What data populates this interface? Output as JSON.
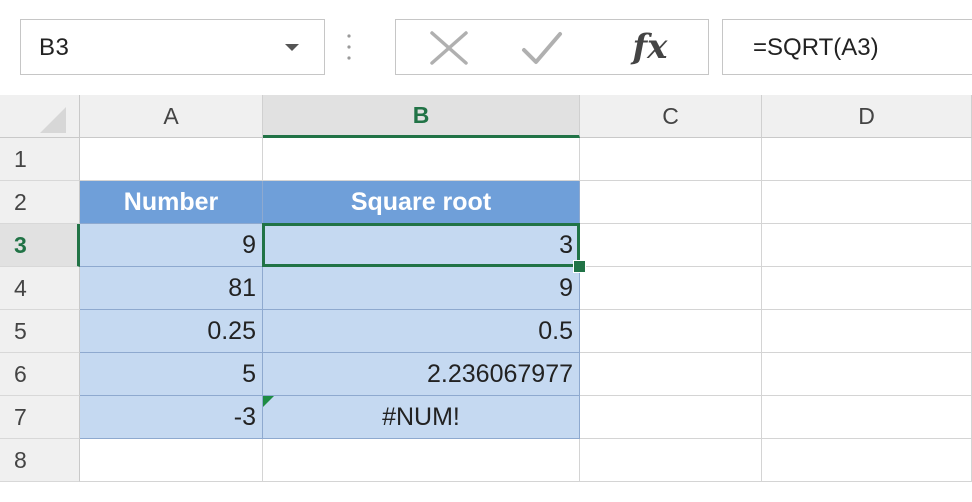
{
  "formula_bar": {
    "name_box": "B3",
    "formula": "=SQRT(A3)",
    "fx_label": "fx"
  },
  "columns": [
    "A",
    "B",
    "C",
    "D"
  ],
  "active_cell": "B3",
  "rows": [
    {
      "num": "1",
      "A": "",
      "B": ""
    },
    {
      "num": "2",
      "A": "Number",
      "B": "Square root"
    },
    {
      "num": "3",
      "A": "9",
      "B": "3"
    },
    {
      "num": "4",
      "A": "81",
      "B": "9"
    },
    {
      "num": "5",
      "A": "0.25",
      "B": "0.5"
    },
    {
      "num": "6",
      "A": "5",
      "B": "2.236067977"
    },
    {
      "num": "7",
      "A": "-3",
      "B": "#NUM!"
    },
    {
      "num": "8",
      "A": "",
      "B": ""
    }
  ],
  "icons": {
    "name_box_dropdown": "chevron-down-icon",
    "cancel": "close-icon",
    "enter": "checkmark-icon",
    "insert_function": "fx-icon"
  },
  "colors": {
    "accent": "#217346",
    "table_header": "#6f9fd9",
    "table_body": "#c5d9f1",
    "error_indicator": "#1e8c44"
  }
}
